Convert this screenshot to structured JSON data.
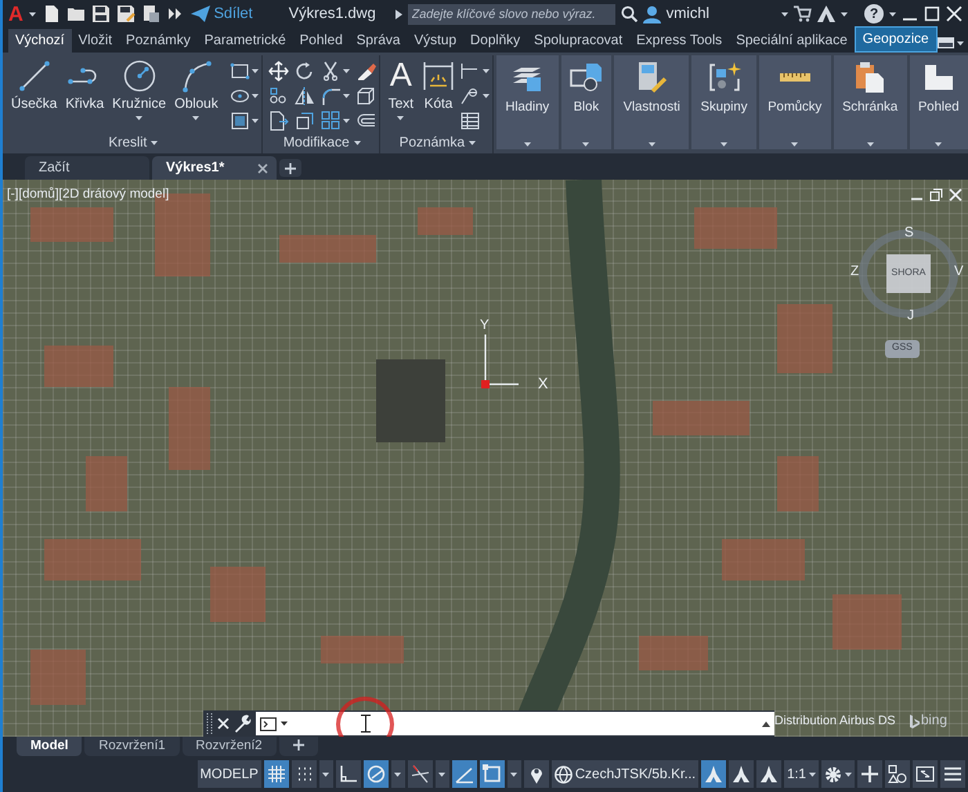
{
  "title_bar": {
    "logo": "A",
    "share": "Sdílet",
    "file_name": "Výkres1.dwg",
    "search": {
      "placeholder": "Zadejte klíčové slovo nebo výraz."
    },
    "user": "vmichl",
    "help": "?"
  },
  "ribbon_tabs": [
    {
      "label": "Výchozí",
      "selected": true,
      "contextual": false
    },
    {
      "label": "Vložit",
      "selected": false,
      "contextual": false
    },
    {
      "label": "Poznámky",
      "selected": false,
      "contextual": false
    },
    {
      "label": "Parametrické",
      "selected": false,
      "contextual": false
    },
    {
      "label": "Pohled",
      "selected": false,
      "contextual": false
    },
    {
      "label": "Správa",
      "selected": false,
      "contextual": false
    },
    {
      "label": "Výstup",
      "selected": false,
      "contextual": false
    },
    {
      "label": "Doplňky",
      "selected": false,
      "contextual": false
    },
    {
      "label": "Spolupracovat",
      "selected": false,
      "contextual": false
    },
    {
      "label": "Express Tools",
      "selected": false,
      "contextual": false
    },
    {
      "label": "Speciální aplikace",
      "selected": false,
      "contextual": false
    },
    {
      "label": "Geopozice",
      "selected": false,
      "contextual": true
    }
  ],
  "ribbon_panels": [
    {
      "title": "Kreslit",
      "tools": [
        {
          "label": "Úsečka",
          "dropdown": false
        },
        {
          "label": "Křivka",
          "dropdown": false
        },
        {
          "label": "Kružnice",
          "dropdown": true
        },
        {
          "label": "Oblouk",
          "dropdown": true
        }
      ]
    },
    {
      "title": "Modifikace"
    },
    {
      "title": "Poznámka",
      "tools": [
        {
          "label": "Text",
          "glyph": "A",
          "dropdown": true
        },
        {
          "label": "Kóta",
          "dropdown": false
        }
      ]
    }
  ],
  "collapsed_panels": [
    {
      "label": "Hladiny"
    },
    {
      "label": "Blok"
    },
    {
      "label": "Vlastnosti"
    },
    {
      "label": "Skupiny"
    },
    {
      "label": "Pomůcky"
    },
    {
      "label": "Schránka"
    },
    {
      "label": "Pohled"
    }
  ],
  "document_tabs": [
    {
      "label": "Začít",
      "selected": false
    },
    {
      "label": "Výkres1*",
      "selected": true
    }
  ],
  "viewport": {
    "label": "[-][domů][2D drátový model]",
    "viewcube": {
      "face": "SHORA",
      "north": "S",
      "east": "V",
      "south": "J",
      "west": "Z",
      "coordinate_system": "GSS"
    },
    "ucs": {
      "x": "X",
      "y": "Y"
    },
    "attribution": "Distribution Airbus DS",
    "logo": "bing"
  },
  "layout_tabs": [
    {
      "label": "Model",
      "selected": true
    },
    {
      "label": "Rozvržení1",
      "selected": false
    },
    {
      "label": "Rozvržení2",
      "selected": false
    }
  ],
  "status_bar": {
    "space": "MODELP",
    "drafting_toggles": [
      {
        "on": true
      },
      {
        "on": false
      },
      {
        "on": false
      },
      {
        "on": true
      },
      {
        "on": false
      },
      {
        "on": true
      },
      {
        "on": true
      }
    ],
    "coordinate_system": "CzechJTSK/5b.Kr...",
    "annotation_toggles": [
      {
        "on": true
      },
      {
        "on": false
      },
      {
        "on": false
      }
    ],
    "scale": "1:1"
  }
}
